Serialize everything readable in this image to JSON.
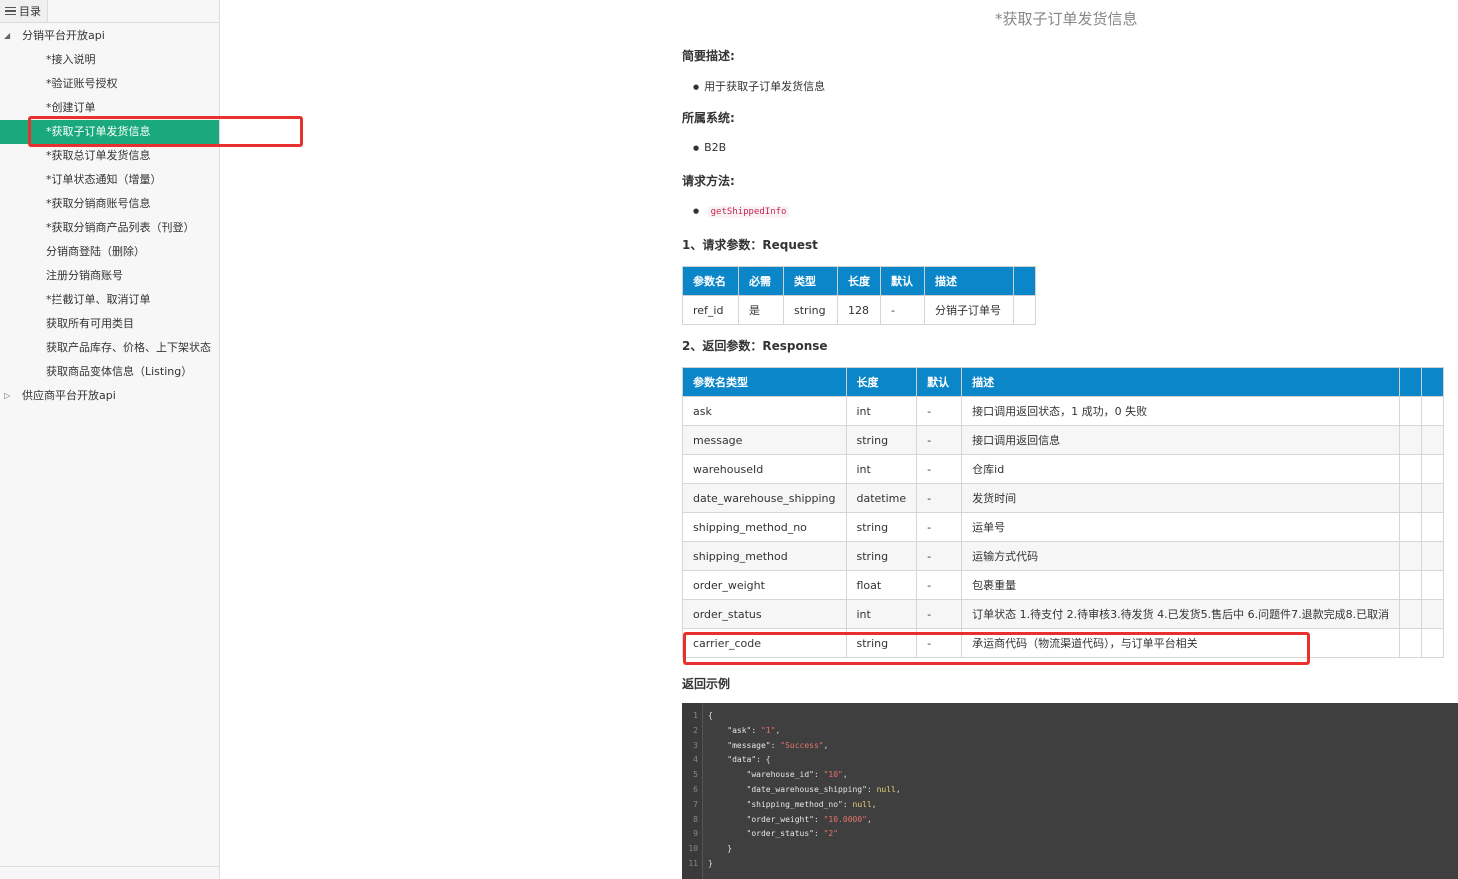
{
  "sidebar": {
    "tab_label": "目录",
    "items": [
      {
        "label": "分销平台开放api",
        "level": 1,
        "toggle": "◢"
      },
      {
        "label": "*接入说明",
        "level": 2
      },
      {
        "label": "*验证账号授权",
        "level": 2
      },
      {
        "label": "*创建订单",
        "level": 2
      },
      {
        "label": "*获取子订单发货信息",
        "level": 2,
        "active": true
      },
      {
        "label": "*获取总订单发货信息",
        "level": 2
      },
      {
        "label": "*订单状态通知（增量）",
        "level": 2
      },
      {
        "label": "*获取分销商账号信息",
        "level": 2
      },
      {
        "label": "*获取分销商产品列表（刊登）",
        "level": 2
      },
      {
        "label": "分销商登陆（删除）",
        "level": 2
      },
      {
        "label": "注册分销商账号",
        "level": 2
      },
      {
        "label": "*拦截订单、取消订单",
        "level": 2
      },
      {
        "label": "获取所有可用类目",
        "level": 2
      },
      {
        "label": "获取产品库存、价格、上下架状态",
        "level": 2
      },
      {
        "label": "获取商品变体信息（Listing）",
        "level": 2
      },
      {
        "label": "供应商平台开放api",
        "level": 1,
        "toggle": "▷"
      }
    ]
  },
  "page": {
    "title": "*获取子订单发货信息",
    "summary_label": "简要描述:",
    "summary_value": "用于获取子订单发货信息",
    "system_label": "所属系统:",
    "system_value": "B2B",
    "method_label": "请求方法:",
    "method_value": "getShippedInfo",
    "request_label": "1、请求参数：Request",
    "response_label": "2、返回参数：Response",
    "example_label": "返回示例"
  },
  "request_table": {
    "headers": [
      "参数名",
      "必需",
      "类型",
      "长度",
      "默认",
      "描述",
      ""
    ],
    "rows": [
      [
        "ref_id",
        "是",
        "string",
        "128",
        "-",
        "分销子订单号",
        ""
      ]
    ]
  },
  "response_table": {
    "headers": [
      "参数名类型",
      "长度",
      "默认",
      "描述",
      "",
      ""
    ],
    "rows": [
      [
        "ask",
        "int",
        "-",
        "接口调用返回状态，1 成功，0 失败",
        "",
        ""
      ],
      [
        "message",
        "string",
        "-",
        "接口调用返回信息",
        "",
        ""
      ],
      [
        "warehouseId",
        "int",
        "-",
        "仓库id",
        "",
        ""
      ],
      [
        "date_warehouse_shipping",
        "datetime",
        "-",
        "发货时间",
        "",
        ""
      ],
      [
        "shipping_method_no",
        "string",
        "-",
        "运单号",
        "",
        ""
      ],
      [
        "shipping_method",
        "string",
        "-",
        "运输方式代码",
        "",
        ""
      ],
      [
        "order_weight",
        "float",
        "-",
        "包裹重量",
        "",
        ""
      ],
      [
        "order_status",
        "int",
        "-",
        "订单状态 1.待支付 2.待审核3.待发货 4.已发货5.售后中 6.问题件7.退款完成8.已取消",
        "",
        ""
      ],
      [
        "carrier_code",
        "string",
        "-",
        "承运商代码（物流渠道代码），与订单平台相关",
        "",
        ""
      ]
    ]
  },
  "code_example": {
    "lines": [
      {
        "n": "1",
        "indent": "",
        "parts": [
          [
            "p",
            "{"
          ]
        ]
      },
      {
        "n": "2",
        "indent": "    ",
        "parts": [
          [
            "k",
            "\"ask\""
          ],
          [
            "p",
            ": "
          ],
          [
            "s",
            "\"1\""
          ],
          [
            "p",
            ","
          ]
        ]
      },
      {
        "n": "3",
        "indent": "    ",
        "parts": [
          [
            "k",
            "\"message\""
          ],
          [
            "p",
            ": "
          ],
          [
            "s",
            "\"Success\""
          ],
          [
            "p",
            ","
          ]
        ]
      },
      {
        "n": "4",
        "indent": "    ",
        "parts": [
          [
            "k",
            "\"data\""
          ],
          [
            "p",
            ": {"
          ]
        ]
      },
      {
        "n": "5",
        "indent": "        ",
        "parts": [
          [
            "k",
            "\"warehouse_id\""
          ],
          [
            "p",
            ": "
          ],
          [
            "s",
            "\"10\""
          ],
          [
            "p",
            ","
          ]
        ]
      },
      {
        "n": "6",
        "indent": "        ",
        "parts": [
          [
            "k",
            "\"date_warehouse_shipping\""
          ],
          [
            "p",
            ": "
          ],
          [
            "n",
            "null"
          ],
          [
            "p",
            ","
          ]
        ]
      },
      {
        "n": "7",
        "indent": "        ",
        "parts": [
          [
            "k",
            "\"shipping_method_no\""
          ],
          [
            "p",
            ": "
          ],
          [
            "n",
            "null"
          ],
          [
            "p",
            ","
          ]
        ]
      },
      {
        "n": "8",
        "indent": "        ",
        "parts": [
          [
            "k",
            "\"order_weight\""
          ],
          [
            "p",
            ": "
          ],
          [
            "s",
            "\"10.0000\""
          ],
          [
            "p",
            ","
          ]
        ]
      },
      {
        "n": "9",
        "indent": "        ",
        "parts": [
          [
            "k",
            "\"order_status\""
          ],
          [
            "p",
            ": "
          ],
          [
            "s",
            "\"2\""
          ]
        ]
      },
      {
        "n": "10",
        "indent": "    ",
        "parts": [
          [
            "p",
            "}"
          ]
        ]
      },
      {
        "n": "11",
        "indent": "",
        "parts": [
          [
            "p",
            "}"
          ]
        ]
      }
    ]
  },
  "colors": {
    "active_item": "#1aa97b",
    "table_header": "#0a86c9",
    "highlight": "#e8312f",
    "code_bg": "#3f3f3f"
  }
}
